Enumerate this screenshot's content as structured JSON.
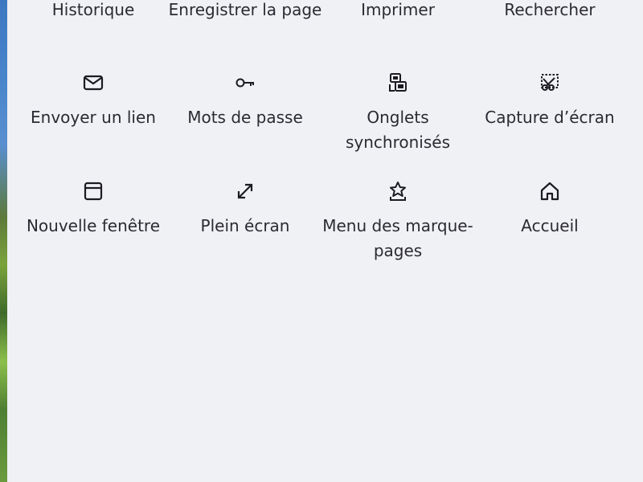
{
  "menu": {
    "top_row": [
      {
        "label": "Historique"
      },
      {
        "label": "Enregistrer la page"
      },
      {
        "label": "Imprimer"
      },
      {
        "label": "Rechercher"
      }
    ],
    "items": [
      {
        "label": "Envoyer un lien",
        "icon": "mail-icon"
      },
      {
        "label": "Mots de passe",
        "icon": "key-icon"
      },
      {
        "label": "Onglets synchronisés",
        "icon": "synced-tabs-icon"
      },
      {
        "label": "Capture d’écran",
        "icon": "screenshot-icon"
      },
      {
        "label": "Nouvelle fenêtre",
        "icon": "new-window-icon"
      },
      {
        "label": "Plein écran",
        "icon": "fullscreen-icon"
      },
      {
        "label": "Menu des marque-pages",
        "icon": "bookmarks-menu-icon"
      },
      {
        "label": "Accueil",
        "icon": "home-icon"
      }
    ]
  },
  "colors": {
    "panel_bg": "#f0f1f4",
    "text": "#2b2a33"
  }
}
